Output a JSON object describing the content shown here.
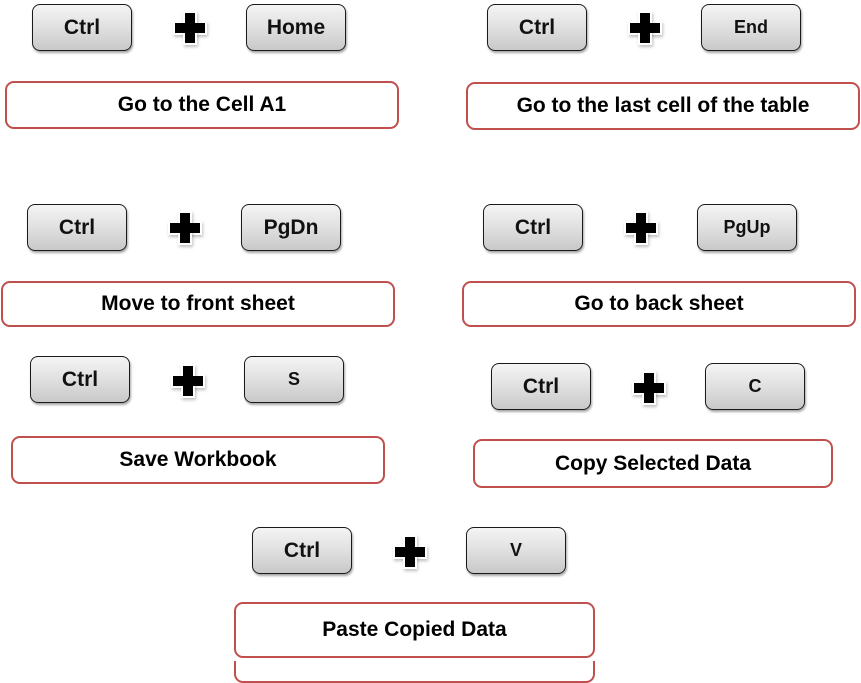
{
  "colors": {
    "description_border": "#c0504d",
    "key_text": "#111111",
    "plus_sign": "#000000"
  },
  "shortcuts": [
    {
      "modifier": "Ctrl",
      "key": "Home",
      "description": "Go to the Cell A1"
    },
    {
      "modifier": "Ctrl",
      "key": "End",
      "description": "Go to the last cell of the table"
    },
    {
      "modifier": "Ctrl",
      "key": "PgDn",
      "description": "Move to front sheet"
    },
    {
      "modifier": "Ctrl",
      "key": "PgUp",
      "description": "Go to back sheet"
    },
    {
      "modifier": "Ctrl",
      "key": "S",
      "description": "Save Workbook"
    },
    {
      "modifier": "Ctrl",
      "key": "C",
      "description": "Copy Selected Data"
    },
    {
      "modifier": "Ctrl",
      "key": "V",
      "description": "Paste Copied Data"
    }
  ],
  "icons": {
    "plus": "plus-icon"
  }
}
